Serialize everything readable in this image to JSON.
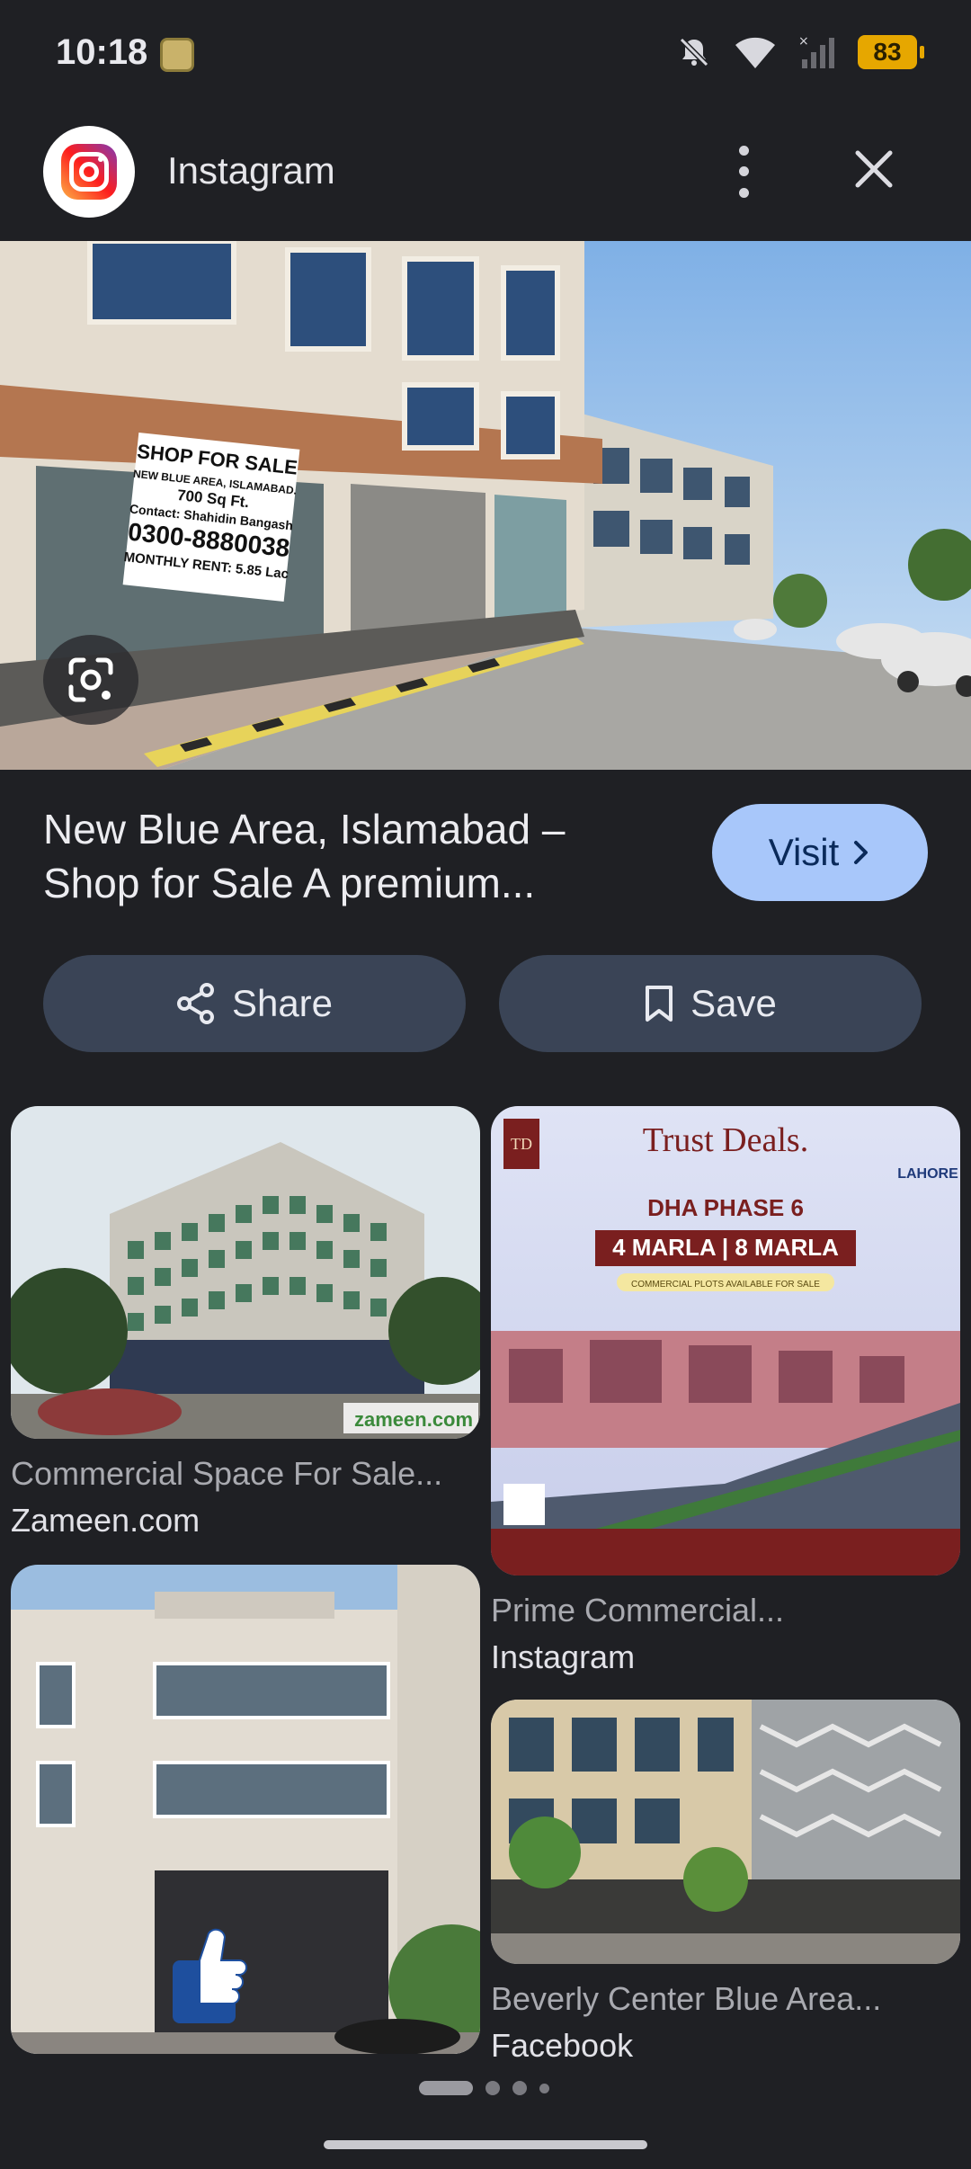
{
  "status": {
    "time": "10:18",
    "battery": "83"
  },
  "header": {
    "site_name": "Instagram"
  },
  "result": {
    "title": "New Blue Area, Islamabad – Shop for Sale A premium...",
    "visit_label": "Visit",
    "share_label": "Share",
    "save_label": "Save",
    "sign_lines": [
      "SHOP FOR SALE",
      "NEW BLUE AREA, ISLAMABAD.",
      "700 Sq Ft.",
      "Contact: Shahidin Bangash",
      "0300-8880038",
      "MONTHLY RENT: 5.85 Lac"
    ]
  },
  "related": [
    {
      "title": "Commercial Space For Sale...",
      "source": "Zameen.com",
      "watermark": "zameen.com"
    },
    {
      "title": "Prime Commercial...",
      "source": "Instagram",
      "ad_brand": "Trust Deals.",
      "ad_headline": "DHA PHASE 6",
      "ad_plots": "4 MARLA | 8 MARLA",
      "ad_sub": "COMMERCIAL PLOTS AVAILABLE FOR SALE",
      "ad_corner": "LAHORE"
    },
    {
      "title": "",
      "source": ""
    },
    {
      "title": "Beverly Center Blue Area...",
      "source": "Facebook"
    }
  ]
}
